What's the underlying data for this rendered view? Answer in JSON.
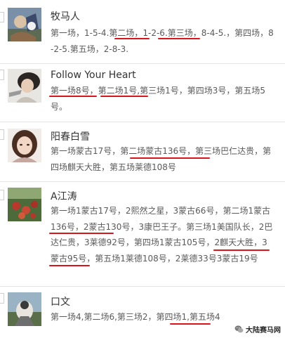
{
  "posts": [
    {
      "name": "牧马人",
      "text": "第一场，1-5-4.第二场，1-2-6.第三场，8-4-5.，第四场，8-2-5.第五场，2-8-3."
    },
    {
      "name": "Follow Your Heart",
      "text": "第一场8号，第二场1号,第三场1号，第四场3号，第五场5号。"
    },
    {
      "name": "阳春白雪",
      "text": "第一场蒙古17号，第二场蒙古136号，第三场巴仁达贵，第四场麒天大胜，第五场莱德108号"
    },
    {
      "name": "A江涛",
      "text": "第一场1蒙古17号，2熙然之星，3蒙古66号，第二场1蒙古136号，2蒙古130号，3康巴王子。第三场1美国队长，2巴达仁贵，3莱德92号，第四场1蒙古105号，2麒天大胜，3蒙古95号，第五场1莱德108号，2莱德33号3蒙古19号"
    },
    {
      "name": "口文",
      "text": "第一场4,第二场6,第三场2，第四场1,第五场4"
    }
  ],
  "watermark": {
    "text": "大陆赛马网",
    "icon": "wechat-icon"
  },
  "colors": {
    "underline": "#d9141b",
    "divider": "#e4e4e4"
  }
}
